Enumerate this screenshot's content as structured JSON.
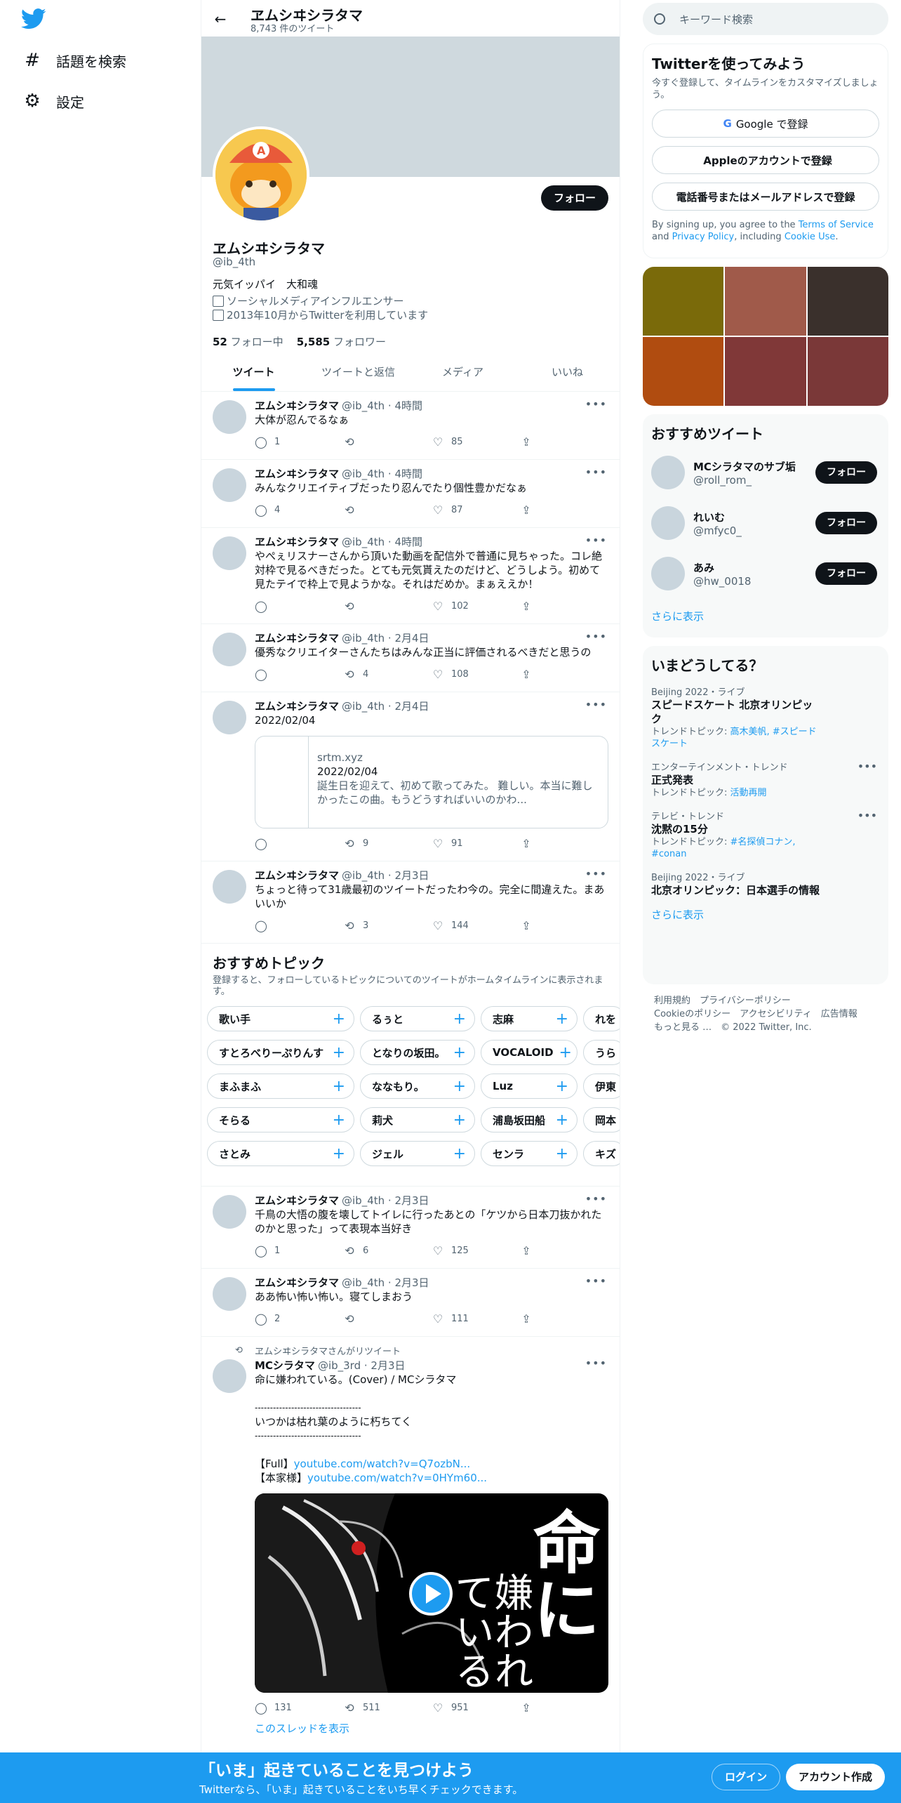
{
  "nav": {
    "items": [
      {
        "icon": "hashtag-icon",
        "label": "話題を検索"
      },
      {
        "icon": "gear-icon",
        "label": "設定"
      }
    ]
  },
  "topbar": {
    "name": "ヱムシヰシラタマ",
    "count": "8,743 件のツイート"
  },
  "profile": {
    "follow_button": "フォロー",
    "name": "ヱムシヰシラタマ",
    "handle": "@ib_4th",
    "bio": "元気イッパイ　大和魂",
    "category": "ソーシャルメディアインフルエンサー",
    "joined": "2013年10月からTwitterを利用しています",
    "following_count": "52",
    "following_label": "フォロー中",
    "followers_count": "5,585",
    "followers_label": "フォロワー"
  },
  "tabs": [
    "ツイート",
    "ツイートと返信",
    "メディア",
    "いいね"
  ],
  "tweets": [
    {
      "name": "ヱムシヰシラタマ",
      "meta": "@ib_4th · 4時間",
      "text": "大体が忍んでるなぁ",
      "reply": "1",
      "retweet": "",
      "like": "85"
    },
    {
      "name": "ヱムシヰシラタマ",
      "meta": "@ib_4th · 4時間",
      "text": "みんなクリエイティブだったり忍んでたり個性豊かだなぁ",
      "reply": "4",
      "retweet": "",
      "like": "87"
    },
    {
      "name": "ヱムシヰシラタマ",
      "meta": "@ib_4th · 4時間",
      "text": "やぺぇリスナーさんから頂いた動画を配信外で普通に見ちゃった。コレ絶対枠で見るべきだった。とても元気貰えたのだけど、どうしよう。初めて見たテイで枠上で見ようかな。それはだめか。まぁええか！",
      "reply": "",
      "retweet": "",
      "like": "102"
    },
    {
      "name": "ヱムシヰシラタマ",
      "meta": "@ib_4th · 2月4日",
      "text": "優秀なクリエイターさんたちはみんな正当に評価されるべきだと思うの",
      "reply": "",
      "retweet": "4",
      "like": "108"
    },
    {
      "name": "ヱムシヰシラタマ",
      "meta": "@ib_4th · 2月4日",
      "text": "2022/02/04",
      "reply": "",
      "retweet": "9",
      "like": "91",
      "card": {
        "domain": "srtm.xyz",
        "title": "2022/02/04",
        "desc": "誕生日を迎えて、初めて歌ってみた。 難しい。本当に難しかったこの曲。もうどうすればいいのかわ..."
      }
    },
    {
      "name": "ヱムシヰシラタマ",
      "meta": "@ib_4th · 2月3日",
      "text": "ちょっと待って31歳最初のツイートだったわ今の。完全に間違えた。まあいいか",
      "reply": "",
      "retweet": "3",
      "like": "144"
    }
  ],
  "topics": {
    "title": "おすすめトピック",
    "subtitle": "登録すると、フォローしているトピックについてのツイートがホームタイムラインに表示されます。",
    "rows": [
      [
        "歌い手",
        "るぅと",
        "志麻",
        "れを"
      ],
      [
        "すとろべりーぷりんす",
        "となりの坂田。",
        "VOCALOID",
        "うら"
      ],
      [
        "まふまふ",
        "ななもり。",
        "Luz",
        "伊東"
      ],
      [
        "そらる",
        "莉犬",
        "浦島坂田船",
        "岡本"
      ],
      [
        "さとみ",
        "ジェル",
        "センラ",
        "キズ"
      ]
    ]
  },
  "tweets2": [
    {
      "name": "ヱムシヰシラタマ",
      "meta": "@ib_4th · 2月3日",
      "text": "千鳥の大悟の腹を壊してトイレに行ったあとの「ケツから日本刀抜かれたのかと思った」って表現本当好き",
      "reply": "1",
      "retweet": "6",
      "like": "125"
    },
    {
      "name": "ヱムシヰシラタマ",
      "meta": "@ib_4th · 2月3日",
      "text": "ああ怖い怖い怖い。寝てしまおう",
      "reply": "2",
      "retweet": "",
      "like": "111"
    }
  ],
  "retweet": {
    "label": "ヱムシヰシラタマさんがリツイート",
    "name": "MCシラタマ",
    "meta": "@ib_3rd · 2月3日",
    "line1": "命に嫌われている。(Cover) / MCシラタマ",
    "sep": "-----------------------------------",
    "line2": "いつかは枯れ葉のように朽ちてく",
    "full_label": "【Full】",
    "full_link": "youtube.com/watch?v=Q7ozbN...",
    "orig_label": "【本家様】",
    "orig_link": "youtube.com/watch?v=0HYm60...",
    "video_title": "命に",
    "video_sub": "嫌われている",
    "reply": "131",
    "retweet": "511",
    "like": "951",
    "thread": "このスレッドを表示"
  },
  "search": {
    "placeholder": "キーワード検索"
  },
  "signup": {
    "title": "Twitterを使ってみよう",
    "sub": "今すぐ登録して、タイムラインをカスタマイズしましょう。",
    "google": "Google で登録",
    "apple": "Appleのアカウントで登録",
    "phone": "電話番号またはメールアドレスで登録",
    "terms_pre": "By signing up, you agree to the ",
    "terms": "Terms of Service",
    "and": " and ",
    "privacy": "Privacy Policy",
    "incl": ", including ",
    "cookie": "Cookie Use",
    "end": "."
  },
  "tiles": [
    "#7a6a0a",
    "#a05a4a",
    "#3a302c",
    "#b04c10",
    "#803838",
    "#7a3838"
  ],
  "recommended": {
    "title": "おすすめツイート",
    "users": [
      {
        "name": "MCシラタマのサブ垢",
        "handle": "@roll_rom_"
      },
      {
        "name": "れいむ",
        "handle": "@mfyc0_"
      },
      {
        "name": "あみ",
        "handle": "@hw_0018"
      }
    ],
    "follow": "フォロー",
    "more": "さらに表示"
  },
  "trends": {
    "title": "いまどうしてる？",
    "items": [
      {
        "cat": "Beijing 2022・ライブ",
        "title": "スピードスケート 北京オリンピック",
        "sub_label": "トレンドトピック: ",
        "sub": "高木美帆, #スピードスケート",
        "dots": false
      },
      {
        "cat": "エンターテインメント・トレンド",
        "title": "正式発表",
        "sub_label": "トレンドトピック: ",
        "sub": "活動再開",
        "dots": true
      },
      {
        "cat": "テレビ・トレンド",
        "title": "沈黙の15分",
        "sub_label": "トレンドトピック: ",
        "sub": "#名探偵コナン, #conan",
        "dots": true
      },
      {
        "cat": "Beijing 2022・ライブ",
        "title": "北京オリンピック：日本選手の情報",
        "sub_label": "",
        "sub": "",
        "dots": false
      }
    ],
    "more": "さらに表示"
  },
  "footer": {
    "line1": "利用規約　プライバシーポリシー",
    "line2": "Cookieのポリシー　アクセシビリティ　広告情報",
    "line3": "もっと見る …　© 2022 Twitter, Inc."
  },
  "bottom": {
    "title": "「いま」起きていることを見つけよう",
    "sub": "Twitterなら、「いま」起きていることをいち早くチェックできます。",
    "login": "ログイン",
    "signup": "アカウント作成"
  }
}
